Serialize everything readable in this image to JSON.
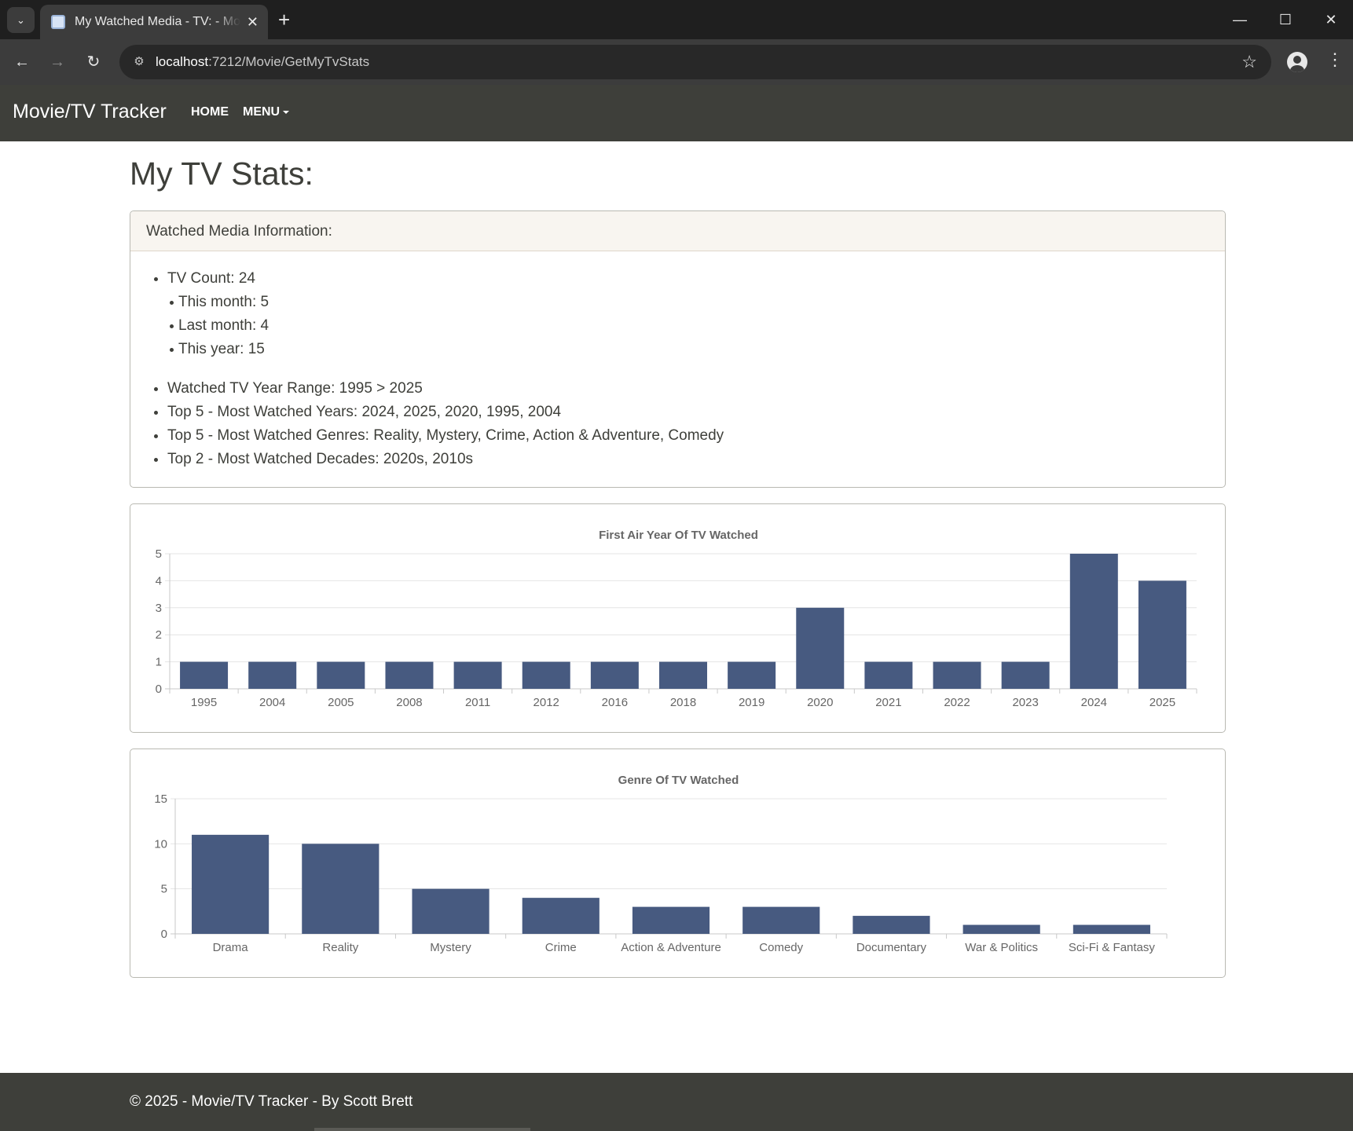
{
  "browser": {
    "tab_title": "My Watched Media - TV: - Movie/TV Tracker",
    "url_host": "localhost",
    "url_path": ":7212/Movie/GetMyTvStats",
    "icons": {
      "tab_search": "chevron-down-icon",
      "close": "close-icon",
      "new_tab": "plus-icon",
      "minimize": "minimize-icon",
      "maximize": "maximize-icon",
      "window_close": "close-icon",
      "back": "arrow-left-icon",
      "forward": "arrow-right-icon",
      "reload": "reload-icon",
      "site_info": "site-info-icon",
      "bookmark": "star-icon",
      "profile": "profile-icon",
      "menu": "kebab-menu-icon"
    }
  },
  "navbar": {
    "brand": "Movie/TV Tracker",
    "home": "HOME",
    "menu": "MENU"
  },
  "page": {
    "title": "My TV Stats:"
  },
  "info": {
    "header": "Watched Media Information:",
    "tv_count": "TV Count: 24",
    "this_month": "This month: 5",
    "last_month": "Last month: 4",
    "this_year": "This year: 15",
    "year_range": "Watched TV Year Range: 1995 > 2025",
    "top_years": "Top 5 - Most Watched Years: 2024, 2025, 2020, 1995, 2004",
    "top_genres": "Top 5 - Most Watched Genres: Reality, Mystery, Crime, Action & Adventure, Comedy",
    "top_decades": "Top 2 - Most Watched Decades: 2020s, 2010s"
  },
  "chart_data": [
    {
      "type": "bar",
      "title": "First Air Year Of TV Watched",
      "categories": [
        "1995",
        "2004",
        "2005",
        "2008",
        "2011",
        "2012",
        "2016",
        "2018",
        "2019",
        "2020",
        "2021",
        "2022",
        "2023",
        "2024",
        "2025"
      ],
      "values": [
        1,
        1,
        1,
        1,
        1,
        1,
        1,
        1,
        1,
        3,
        1,
        1,
        1,
        5,
        4
      ],
      "yticks": [
        0,
        1,
        2,
        3,
        4,
        5
      ],
      "ylim": [
        0,
        5
      ],
      "grid": true,
      "bar_color": "#475a80"
    },
    {
      "type": "bar",
      "title": "Genre Of TV Watched",
      "categories": [
        "Drama",
        "Reality",
        "Mystery",
        "Crime",
        "Action & Adventure",
        "Comedy",
        "Documentary",
        "War & Politics",
        "Sci-Fi & Fantasy"
      ],
      "values": [
        11,
        10,
        5,
        4,
        3,
        3,
        2,
        1,
        1
      ],
      "yticks": [
        0,
        5,
        10,
        15
      ],
      "ylim": [
        0,
        15
      ],
      "grid": true,
      "bar_color": "#475a80"
    }
  ],
  "footer": {
    "text": "© 2025 - Movie/TV Tracker - By Scott Brett"
  }
}
